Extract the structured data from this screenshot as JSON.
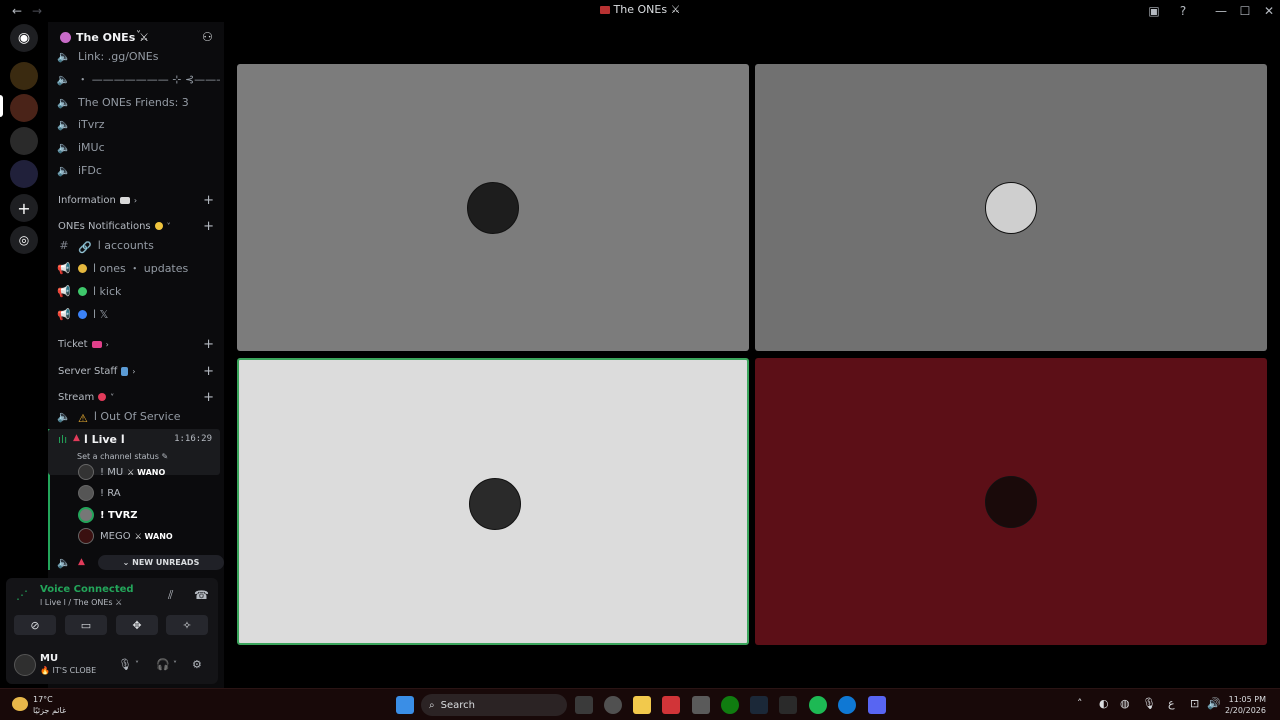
{
  "window": {
    "title": "The ONEs ⚔",
    "controls": [
      "back-icon",
      "forward-icon"
    ],
    "right_icons": [
      "inbox-icon",
      "help-icon",
      "minimize-icon",
      "maximize-icon",
      "close-icon"
    ]
  },
  "guild": {
    "name": "The ONEs ⚔",
    "chevron": "˅"
  },
  "channels": [
    {
      "icon": "speaker",
      "label": "Link: .gg/ONEs"
    },
    {
      "icon": "speaker",
      "label": "・ ——————— ⊹ ⊰———"
    },
    {
      "icon": "speaker",
      "label": "The ONEs Friends: 3"
    },
    {
      "icon": "speaker",
      "label": "iTvrz"
    },
    {
      "icon": "speaker",
      "label": "iMUc"
    },
    {
      "icon": "speaker",
      "label": "iFDc"
    }
  ],
  "categories": {
    "information": "Information",
    "notifications": "ONEs Notifications",
    "ticket": "Ticket",
    "staff": "Server Staff",
    "stream": "Stream"
  },
  "notification_channels": [
    {
      "icon": "#",
      "emoji_color": "#80848e",
      "label": "ا accounts"
    },
    {
      "icon": "📢",
      "emoji_color": "#e5b83e",
      "label": "ا ones ・ updates"
    },
    {
      "icon": "📢",
      "emoji_color": "#3ec86b",
      "label": "ا kick"
    },
    {
      "icon": "📢",
      "emoji_color": "#3b82f6",
      "label": "ا 𝕏"
    }
  ],
  "stream_channels": {
    "out_of_service": "ا Out Of Service",
    "live": "ا Live ا",
    "live_time": "1:16:29",
    "status_prompt": "Set a channel status ✎"
  },
  "members": [
    {
      "name": "! MU",
      "tag": "WANO",
      "bold": false
    },
    {
      "name": "! RA",
      "tag": "",
      "bold": false
    },
    {
      "name": "! TVRZ",
      "tag": "",
      "bold": true
    },
    {
      "name": "MEGO",
      "tag": "WANO",
      "bold": false
    }
  ],
  "new_unreads": "⌄ NEW UNREADS",
  "voice": {
    "title": "Voice Connected",
    "subtitle": "ا Live ا / The ONEs ⚔"
  },
  "user": {
    "name": "MU",
    "status": "🔥 IT'S CLOBE"
  },
  "tiles": [
    {
      "bg": "#7c7c7c",
      "border": "none"
    },
    {
      "bg": "#717171",
      "border": "none"
    },
    {
      "bg": "#dcdcdc",
      "border": "#3ba55c"
    },
    {
      "bg": "#5c0f17",
      "border": "none"
    }
  ],
  "taskbar": {
    "weather_temp": "17°C",
    "weather_desc": "غائم جزئيًا",
    "search_label": "Search",
    "tray_lang": "ع",
    "time": "11:05 PM",
    "date": "2/20/2026"
  }
}
